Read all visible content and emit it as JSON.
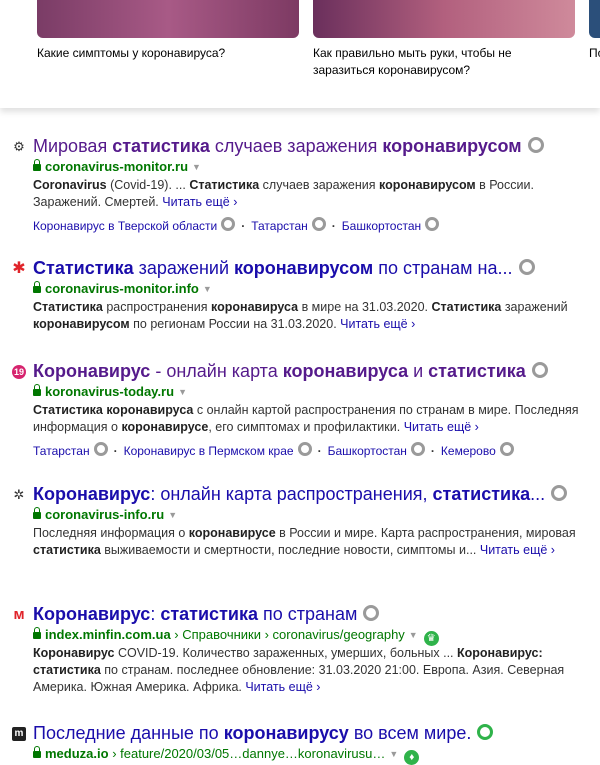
{
  "top_cards": [
    {
      "caption": "Какие симптомы у коронавируса?"
    },
    {
      "caption": "Как правильно мыть руки, чтобы не заразиться коронавирусом?"
    },
    {
      "caption": "По"
    }
  ],
  "results": [
    {
      "title_parts": [
        [
          "Мировая ",
          ""
        ],
        [
          "статистика",
          "b"
        ],
        [
          " случаев заражения ",
          ""
        ],
        [
          "коронавирусом",
          "b"
        ]
      ],
      "domain": "coronavirus-monitor.ru",
      "snippet_parts": [
        [
          "Coronavirus",
          "b"
        ],
        [
          " (Covid-19). ... ",
          ""
        ],
        [
          "Статистика",
          "b"
        ],
        [
          " случаев заражения ",
          ""
        ],
        [
          "коронавирусом",
          "b"
        ],
        [
          " в России. Заражений. Смертей. ",
          ""
        ]
      ],
      "more": "Читать ещё ›",
      "sitelinks": [
        "Коронавирус в Тверской области",
        "Татарстан",
        "Башкортостан"
      ]
    },
    {
      "title_parts": [
        [
          "Статистика",
          "b"
        ],
        [
          " заражений ",
          ""
        ],
        [
          "коронавирусом",
          "b"
        ],
        [
          " по странам на...",
          ""
        ]
      ],
      "domain": "coronavirus-monitor.info",
      "snippet_parts": [
        [
          "Статистика",
          "b"
        ],
        [
          " распространения ",
          ""
        ],
        [
          "коронавируса",
          "b"
        ],
        [
          " в мире на 31.03.2020. ",
          ""
        ],
        [
          "Статистика",
          "b"
        ],
        [
          " заражений ",
          ""
        ],
        [
          "коронавирусом",
          "b"
        ],
        [
          " по регионам России на 31.03.2020. ",
          ""
        ]
      ],
      "more": "Читать ещё ›"
    },
    {
      "title_parts": [
        [
          "Коронавирус",
          "b"
        ],
        [
          " - онлайн карта ",
          ""
        ],
        [
          "коронавируса",
          "b"
        ],
        [
          " и ",
          ""
        ],
        [
          "статистика",
          "b"
        ]
      ],
      "domain": "koronavirus-today.ru",
      "snippet_parts": [
        [
          "Статистика коронавируса",
          "b"
        ],
        [
          " с онлайн картой распространения по странам в мире. Последняя информация о ",
          ""
        ],
        [
          "коронавирусе",
          "b"
        ],
        [
          ", его симптомах и профилактики. ",
          ""
        ]
      ],
      "more": "Читать ещё ›",
      "sitelinks": [
        "Татарстан",
        "Коронавирус в Пермском крае",
        "Башкортостан",
        "Кемерово"
      ]
    },
    {
      "title_parts": [
        [
          "Коронавирус",
          "b"
        ],
        [
          ": онлайн карта распространения, ",
          ""
        ],
        [
          "статистика",
          "b"
        ],
        [
          "...",
          ""
        ]
      ],
      "domain": "coronavirus-info.ru",
      "snippet_parts": [
        [
          "Последняя информация о ",
          ""
        ],
        [
          "коронавирусе",
          "b"
        ],
        [
          " в России и мире. Карта распространения, мировая ",
          ""
        ],
        [
          "статистика",
          "b"
        ],
        [
          " выживаемости и смертности, последние новости, симптомы и... ",
          ""
        ]
      ],
      "more": "Читать ещё ›"
    },
    {
      "title_parts": [
        [
          "Коронавирус",
          "b"
        ],
        [
          ": ",
          ""
        ],
        [
          "статистика",
          "b"
        ],
        [
          " по странам",
          ""
        ]
      ],
      "domain": "index.minfin.com.ua",
      "path": " › Справочники › coronavirus/geography",
      "snippet_parts": [
        [
          "Коронавирус",
          "b"
        ],
        [
          " COVID-19. Количество зараженных, умерших, больных ... ",
          ""
        ],
        [
          "Коронавирус: статистика",
          "b"
        ],
        [
          " по странам. последнее обновление: 31.03.2020 21:00. Европа. Азия. Северная Америка. Южная Америка. Африка. ",
          ""
        ]
      ],
      "more": "Читать ещё ›"
    },
    {
      "title_parts": [
        [
          "Последние данные по ",
          ""
        ],
        [
          "коронавирусу",
          "b"
        ],
        [
          " во всем мире.",
          ""
        ]
      ],
      "domain": "meduza.io",
      "path": " › feature/2020/03/05…dannye…koronavirusu…"
    }
  ],
  "favicons": [
    "gear-icon",
    "star-burst-icon",
    "covid-icon",
    "settings-icon",
    "m-logo-icon",
    "meduza-logo-icon"
  ],
  "colors": {
    "link": "#1a0dab",
    "url_green": "#007700",
    "badge_green": "#2fb34a"
  }
}
